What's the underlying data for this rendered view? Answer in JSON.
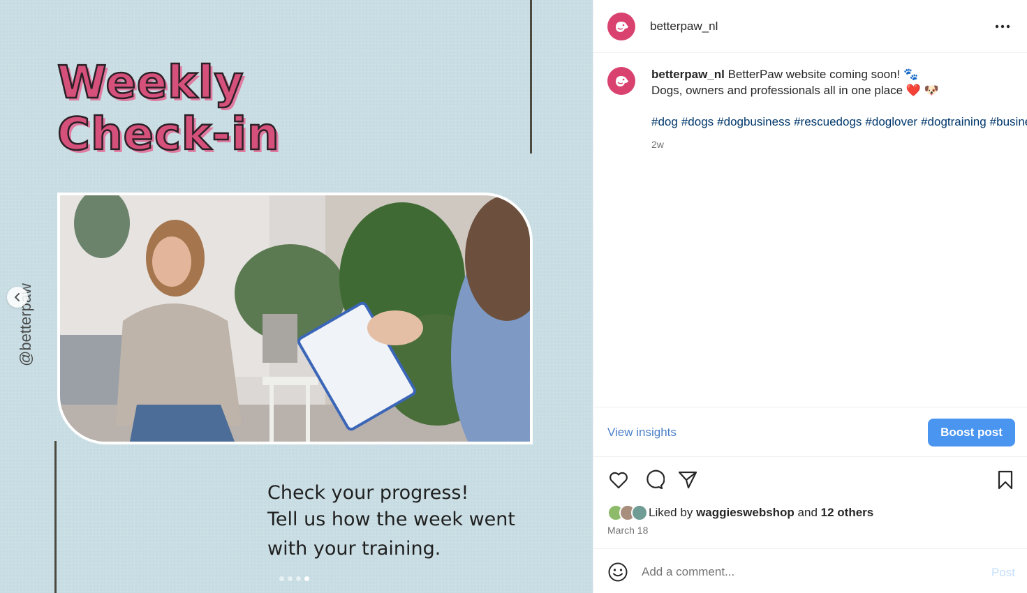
{
  "post_media": {
    "title_line1": "Weekly",
    "title_line2": "Check-in",
    "side_handle": "@betterpaw",
    "caption_lines": [
      "Check your progress!",
      "Tell us how the week went",
      "with your training."
    ],
    "carousel": {
      "total": 4,
      "active_index": 3
    },
    "background_color": "#c8dde3",
    "title_color": "#d6507c"
  },
  "header": {
    "username": "betterpaw_nl",
    "avatar_icon": "dog-logo-icon",
    "more_icon": "more-options-icon"
  },
  "caption": {
    "username": "betterpaw_nl",
    "line1": "BetterPaw website coming soon!",
    "line1_emoji": "🐾",
    "line2": "Dogs, owners and professionals all in one place",
    "line2_emoji": "❤️ 🐶",
    "hashtags": [
      "#dog",
      "#dogs",
      "#dogbusiness",
      "#rescuedogs",
      "#doglover",
      "#dogtraining",
      "#businesspaw"
    ],
    "age": "2w"
  },
  "insights": {
    "view_label": "View insights",
    "boost_label": "Boost post",
    "accent": "#4a95f0"
  },
  "actions": {
    "icons": [
      "heart-icon",
      "comment-icon",
      "share-icon",
      "bookmark-icon"
    ]
  },
  "likes": {
    "prefix": "Liked by",
    "user": "waggieswebshop",
    "middle": "and",
    "others": "12 others",
    "date": "March 18"
  },
  "comment_box": {
    "placeholder": "Add a comment...",
    "post_label": "Post"
  }
}
